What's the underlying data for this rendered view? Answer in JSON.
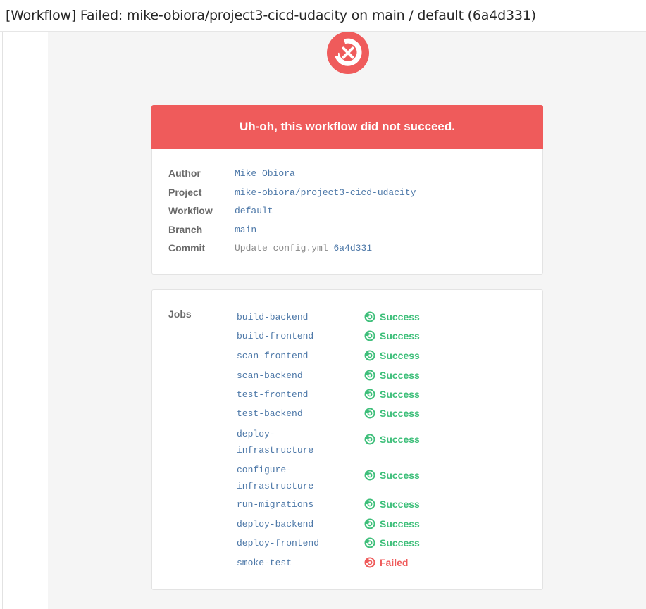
{
  "email": {
    "subject": "[Workflow] Failed: mike-obiora/project3-cicd-udacity on main / default (6a4d331)"
  },
  "brand": {
    "logo_icon": "circleci-failed-logo-icon",
    "accent_color": "#ef5b5b",
    "success_color": "#3ebf7a",
    "link_color": "#4d78a8"
  },
  "banner": {
    "text": "Uh-oh, this workflow did not succeed."
  },
  "summary": {
    "author_label": "Author",
    "author_value": "Mike Obiora",
    "project_label": "Project",
    "project_value": "mike-obiora/project3-cicd-udacity",
    "workflow_label": "Workflow",
    "workflow_value": "default",
    "branch_label": "Branch",
    "branch_value": "main",
    "commit_label": "Commit",
    "commit_message": "Update config.yml",
    "commit_hash": "6a4d331"
  },
  "jobs": {
    "label": "Jobs",
    "items": [
      {
        "name": "build-backend",
        "status": "Success"
      },
      {
        "name": "build-frontend",
        "status": "Success"
      },
      {
        "name": "scan-frontend",
        "status": "Success"
      },
      {
        "name": "scan-backend",
        "status": "Success"
      },
      {
        "name": "test-frontend",
        "status": "Success"
      },
      {
        "name": "test-backend",
        "status": "Success"
      },
      {
        "name": "deploy-infrastructure",
        "status": "Success"
      },
      {
        "name": "configure-infrastructure",
        "status": "Success"
      },
      {
        "name": "run-migrations",
        "status": "Success"
      },
      {
        "name": "deploy-backend",
        "status": "Success"
      },
      {
        "name": "deploy-frontend",
        "status": "Success"
      },
      {
        "name": "smoke-test",
        "status": "Failed"
      }
    ]
  }
}
